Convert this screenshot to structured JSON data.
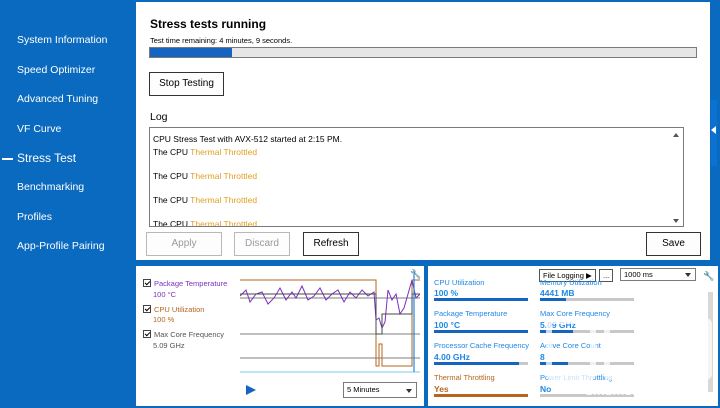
{
  "sidebar": {
    "items": [
      {
        "label": "System Information"
      },
      {
        "label": "Speed Optimizer"
      },
      {
        "label": "Advanced Tuning"
      },
      {
        "label": "VF Curve"
      },
      {
        "label": "Stress Test",
        "active": true
      },
      {
        "label": "Benchmarking"
      },
      {
        "label": "Profiles"
      },
      {
        "label": "App-Profile Pairing"
      }
    ]
  },
  "stress": {
    "title": "Stress tests running",
    "remaining": "Test time remaining: 4 minutes, 9 seconds.",
    "progress": 0.15,
    "stop_label": "Stop Testing",
    "log_label": "Log",
    "log_lines": [
      {
        "prefix": "CPU Stress Test with AVX-512 started at 2:15 PM.",
        "warn": ""
      },
      {
        "prefix": "The CPU ",
        "warn": "Thermal Throttled"
      },
      {
        "prefix": "The CPU ",
        "warn": "Thermal Throttled"
      },
      {
        "prefix": "The CPU ",
        "warn": "Thermal Throttled"
      },
      {
        "prefix": "The CPU ",
        "warn": "Thermal Throttled"
      }
    ],
    "apply_label": "Apply",
    "discard_label": "Discard",
    "refresh_label": "Refresh",
    "save_label": "Save"
  },
  "graph": {
    "series": [
      {
        "label": "Package Temperature",
        "value": "100 °C",
        "color": "#7b2fbf"
      },
      {
        "label": "CPU Utilization",
        "value": "100 %",
        "color": "#b5651d"
      },
      {
        "label": "Max Core Frequency",
        "value": "5.09 GHz",
        "color": "#555555"
      }
    ],
    "duration": "5 Minutes"
  },
  "metrics": {
    "file_logging_label": "File Logging ▶",
    "more_label": "...",
    "interval": "1000 ms",
    "items": [
      {
        "label": "CPU Utilization",
        "value": "100 %",
        "level": 1.0
      },
      {
        "label": "Memory Utilization",
        "value": "4441  MB",
        "level": 0.28
      },
      {
        "label": "Package Temperature",
        "value": "100 °C",
        "level": 1.0
      },
      {
        "label": "Max Core Frequency",
        "value": "5.09 GHz",
        "level": 0.35
      },
      {
        "label": "Processor Cache Frequency",
        "value": "4.00 GHz",
        "level": 0.9
      },
      {
        "label": "Active Core Count",
        "value": "8",
        "level": 0.3
      },
      {
        "label": "Thermal Throttling",
        "value": "Yes",
        "level": 1.0,
        "warn": true
      },
      {
        "label": "Power Limit Throttling",
        "value": "No",
        "level": 0.0
      }
    ]
  },
  "watermark": {
    "text": "zhizhizhi.com"
  }
}
